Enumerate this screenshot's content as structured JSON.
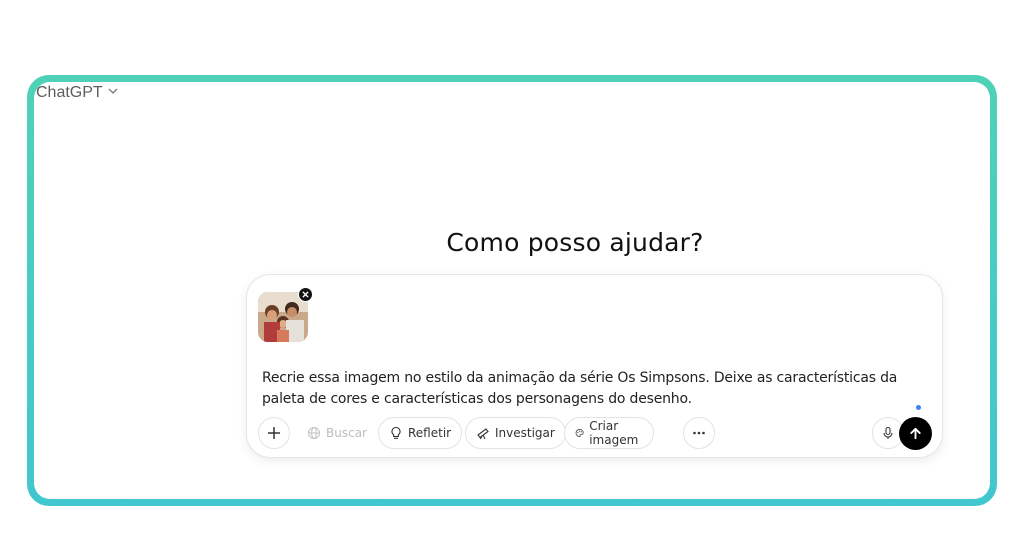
{
  "header": {
    "model_name": "ChatGPT"
  },
  "main": {
    "headline": "Como posso ajudar?"
  },
  "composer": {
    "prompt_text": "Recrie essa imagem no estilo da animação da série Os Simpsons. Deixe as características da paleta de cores e características dos personagens do desenho.",
    "tools": {
      "search_label": "Buscar",
      "reason_label": "Refletir",
      "research_label": "Investigar",
      "image_label": "Criar imagem"
    }
  },
  "colors": {
    "frame_gradient_top": "#4fd1b8",
    "frame_gradient_bottom": "#40c7cf",
    "send_button": "#000000",
    "status_dot": "#3b82f6"
  },
  "icons": {
    "model_dropdown": "chevron-down-icon",
    "attachment_remove": "close-icon",
    "add": "plus-icon",
    "search": "globe-icon",
    "reason": "lightbulb-icon",
    "research": "telescope-icon",
    "image": "palette-icon",
    "more": "ellipsis-icon",
    "voice": "microphone-icon",
    "send": "arrow-up-icon"
  }
}
